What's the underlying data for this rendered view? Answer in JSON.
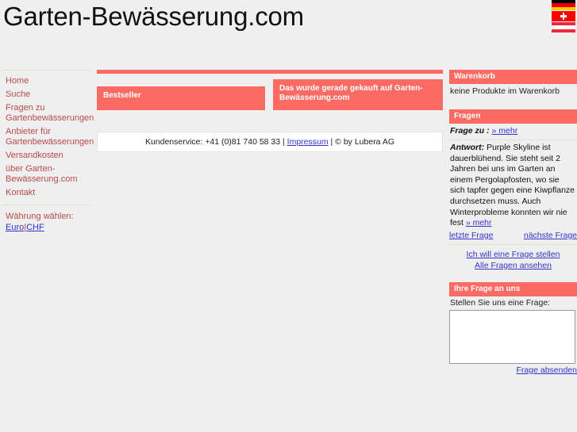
{
  "header": {
    "site_title": "Garten-Bewässerung.com",
    "flags": [
      {
        "name": "flag-germany",
        "label": "Deutschland"
      },
      {
        "name": "flag-switzerland",
        "label": "Schweiz"
      },
      {
        "name": "flag-austria",
        "label": "Österreich"
      }
    ]
  },
  "sidebar": {
    "items": [
      {
        "label": "Home"
      },
      {
        "label": "Suche"
      },
      {
        "label": "Fragen zu Gartenbewässerungen"
      },
      {
        "label": "Anbieter für Gartenbewässerungen"
      },
      {
        "label": "Versandkosten"
      },
      {
        "label": "über Garten-Bewässerung.com"
      },
      {
        "label": "Kontakt"
      }
    ],
    "currency": {
      "label": "Währung wählen:",
      "euro": "Euro",
      "separator": "|",
      "chf": "CHF"
    }
  },
  "center": {
    "bestseller_title": "Bestseller",
    "justbought_title": "Das wurde gerade gekauft auf Garten-Bewässerung.com",
    "footer": {
      "service_text": "Kundenservice: +41 (0)81 740 58 33 | ",
      "impressum": "Impressum",
      "copyright": " | © by Lubera AG"
    }
  },
  "right": {
    "cart": {
      "title": "Warenkorb",
      "body": "keine Produkte im Warenkorb"
    },
    "questions": {
      "title": "Fragen",
      "frage_zu_label": "Frage zu :",
      "frage_zu_more": "» mehr",
      "antwort_label": "Antwort:",
      "antwort_text": " Purple Skyline ist dauerblühend. Sie steht seit 2 Jahren bei uns im Garten an einem Pergolapfosten, wo sie sich tapfer gegen eine Kiwpflanze durchsetzen muss. Auch Winterprobleme konnten wir nie fest ",
      "antwort_more": "» mehr",
      "prev_label": "letzte Frage",
      "next_label": "nächste Frage",
      "ask_link": "Ich will eine Frage stellen",
      "view_all_link": "Alle Fragen ansehen"
    },
    "ask_form": {
      "title": "Ihre Frage an uns",
      "prompt": "Stellen Sie uns eine Frage:",
      "textarea_value": "",
      "submit_link": "Frage absenden"
    }
  },
  "colors": {
    "accent": "#fb6b63",
    "page_background": "#efefef",
    "link": "#3333cc",
    "nav_text": "#b94a4a",
    "separator": "#c8dca0"
  }
}
